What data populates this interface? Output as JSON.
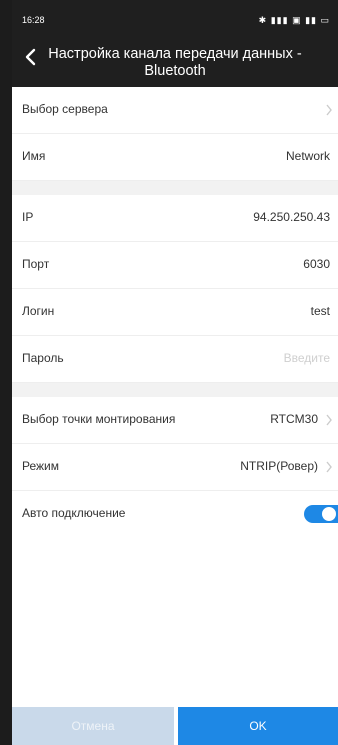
{
  "status_bar": {
    "time": "16:28",
    "icons": "✱ ▮▮▮ ▣ ▮▮ ▭"
  },
  "header": {
    "title": "Настройка канала передачи данных - Bluetooth"
  },
  "rows": {
    "server": {
      "label": "Выбор сервера"
    },
    "name": {
      "label": "Имя",
      "value": "Network"
    },
    "ip": {
      "label": "IP",
      "value": "94.250.250.43"
    },
    "port": {
      "label": "Порт",
      "value": "6030"
    },
    "login": {
      "label": "Логин",
      "value": "test"
    },
    "password": {
      "label": "Пароль",
      "placeholder": "Введите"
    },
    "mount": {
      "label": "Выбор точки монтирования",
      "value": "RTCM30"
    },
    "mode": {
      "label": "Режим",
      "value": "NTRIP(Ровер)"
    },
    "auto": {
      "label": "Авто подключение",
      "enabled": true
    }
  },
  "footer": {
    "cancel_label": "Отмена",
    "ok_label": "OK"
  },
  "colors": {
    "accent": "#1e88e5",
    "topbar": "#1f1f1f",
    "cancel_disabled": "#c9d9ea"
  }
}
